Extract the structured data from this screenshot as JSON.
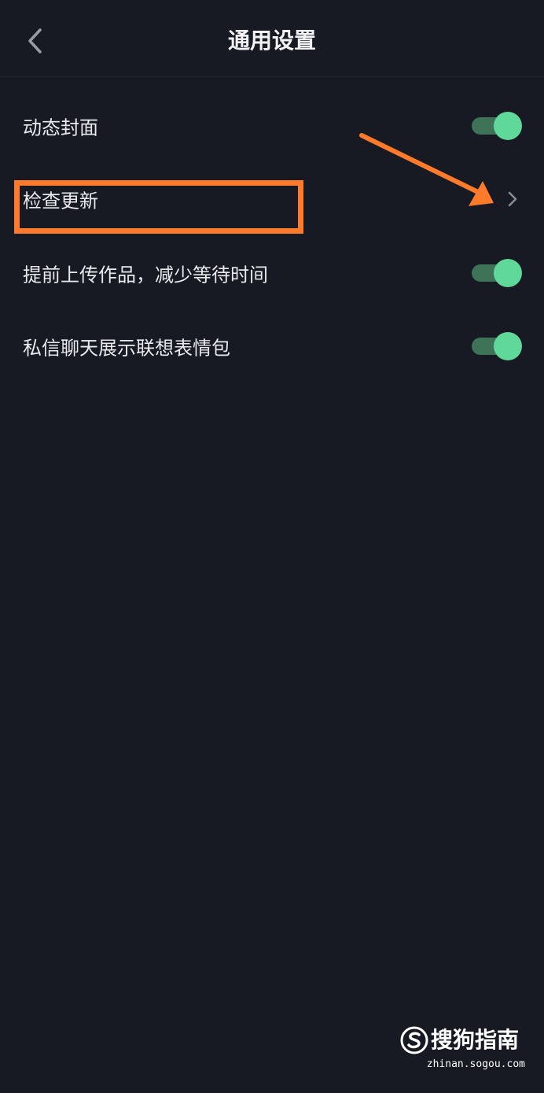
{
  "header": {
    "title": "通用设置",
    "back_icon": "chevron-left-icon"
  },
  "settings": [
    {
      "label": "动态封面",
      "control": "toggle",
      "enabled": true
    },
    {
      "label": "检查更新",
      "control": "chevron",
      "icon": "chevron-right-icon"
    },
    {
      "label": "提前上传作品，减少等待时间",
      "control": "toggle",
      "enabled": true
    },
    {
      "label": "私信聊天展示联想表情包",
      "control": "toggle",
      "enabled": true
    }
  ],
  "annotation": {
    "highlight_color": "#ff7a2a",
    "arrow_icon": "arrow-icon"
  },
  "watermark": {
    "brand": "搜狗指南",
    "url": "zhinan.sogou.com",
    "logo_icon": "sogou-logo-icon"
  },
  "colors": {
    "background": "#171923",
    "toggle_on_knob": "#5fd89a",
    "toggle_on_track": "#3f7358",
    "text": "#e9eaee"
  }
}
